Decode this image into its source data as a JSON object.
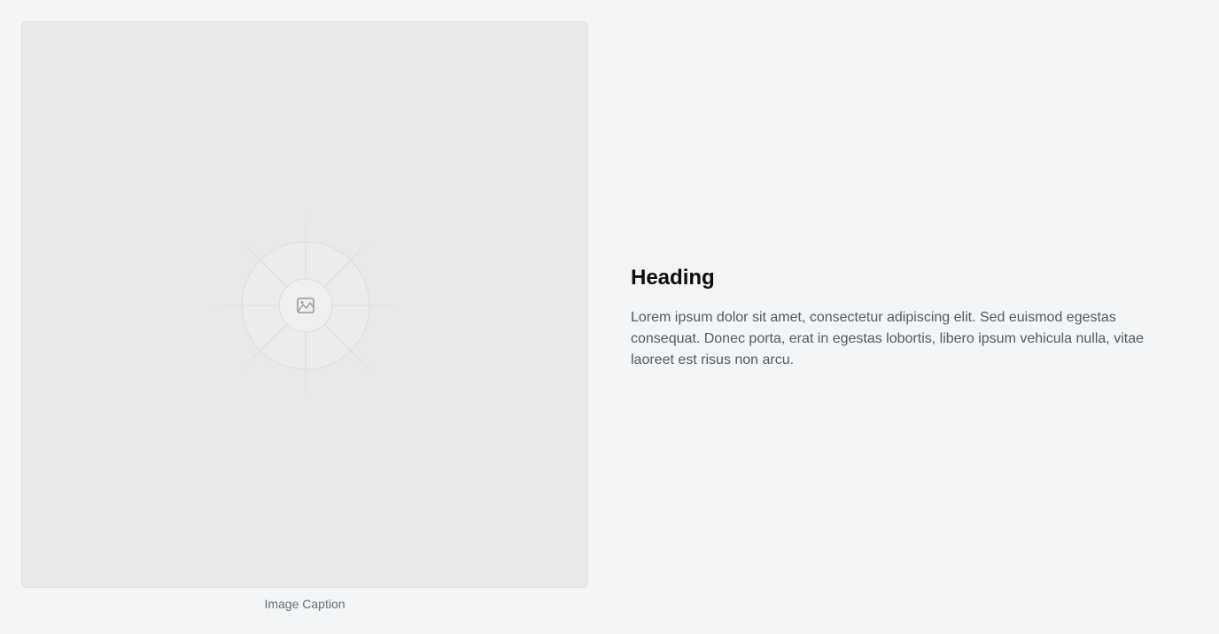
{
  "media": {
    "icon": "image-icon",
    "caption": "Image Caption"
  },
  "content": {
    "heading": "Heading",
    "body": "Lorem ipsum dolor sit amet, consectetur adipiscing elit. Sed euismod egestas consequat. Donec porta, erat in egestas lobortis, libero ipsum vehicula nulla, vitae laoreet est risus non arcu."
  },
  "colors": {
    "page_background": "#f2f4f5",
    "placeholder_background": "#e9e9ea",
    "heading_text": "#0c0d0e",
    "body_text": "#555b61",
    "caption_text": "#6b7075"
  }
}
